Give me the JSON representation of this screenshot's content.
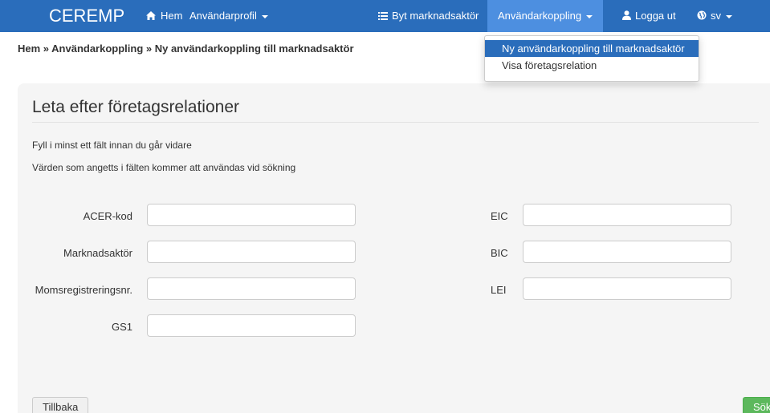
{
  "navbar": {
    "brand": "CEREMP",
    "home": "Hem",
    "user_profile": "Användarprofil",
    "switch_market_actor": "Byt marknadsaktör",
    "user_linking": "Användarkoppling",
    "logout": "Logga ut",
    "language": "sv"
  },
  "breadcrumb": "Hem » Användarkoppling » Ny användarkoppling till marknadsaktör",
  "dropdown": {
    "items": [
      "Ny användarkoppling till marknadsaktör",
      "Visa företagsrelation"
    ]
  },
  "panel": {
    "title": "Leta efter företagsrelationer",
    "help1": "Fyll i minst ett fält innan du går vidare",
    "help2": "Värden som angetts i fälten kommer att användas vid sökning"
  },
  "form": {
    "left": [
      {
        "label": "ACER-kod",
        "value": ""
      },
      {
        "label": "Marknadsaktör",
        "value": ""
      },
      {
        "label": "Momsregistreringsnr.",
        "value": ""
      },
      {
        "label": "GS1",
        "value": ""
      }
    ],
    "right": [
      {
        "label": "EIC",
        "value": ""
      },
      {
        "label": "BIC",
        "value": ""
      },
      {
        "label": "LEI",
        "value": ""
      }
    ]
  },
  "buttons": {
    "back": "Tillbaka",
    "search": "Sök"
  },
  "colors": {
    "navbar": "#2a6dbb",
    "nav_active": "#4d8fe0",
    "search_button": "#5cb85c"
  }
}
